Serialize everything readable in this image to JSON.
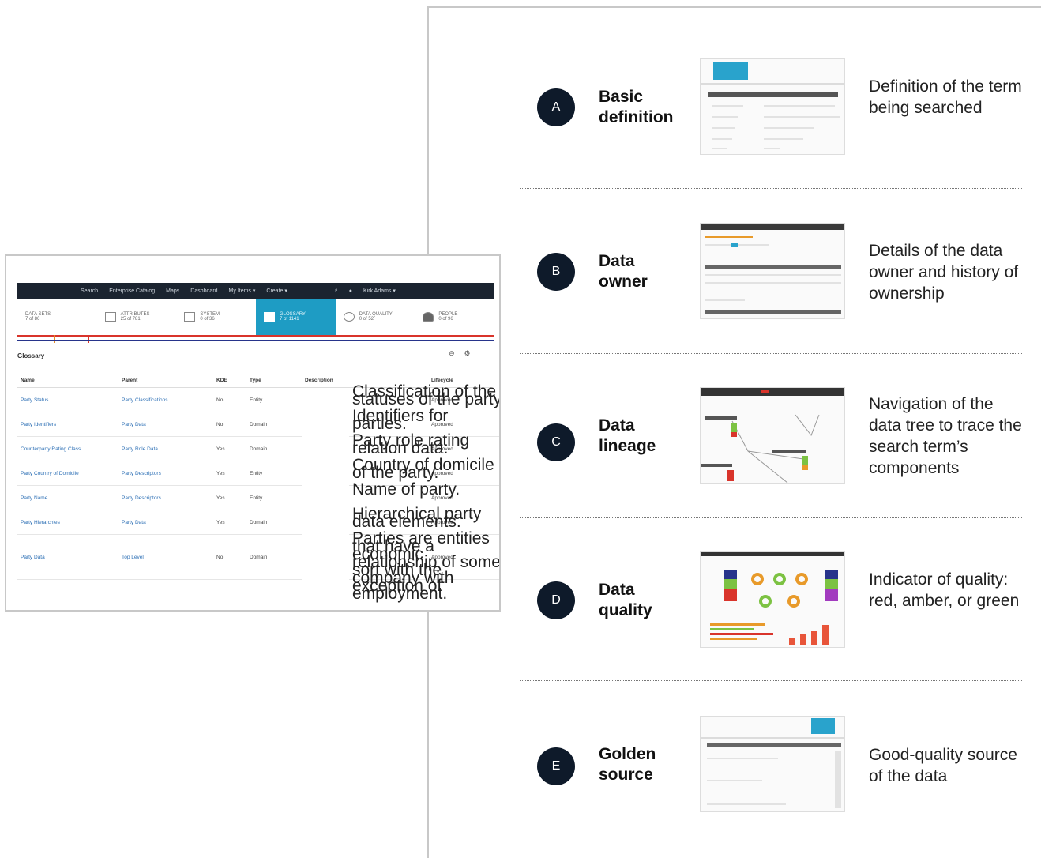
{
  "screenshot": {
    "nav": [
      "Search",
      "Enterprise Catalog",
      "Maps",
      "Dashboard",
      "My Items ▾",
      "Create ▾",
      "Kirk Adams ▾"
    ],
    "tiles": [
      {
        "label": "DATA SETS",
        "sub": "7 of 86"
      },
      {
        "label": "ATTRIBUTES",
        "sub": "25 of 781"
      },
      {
        "label": "SYSTEM",
        "sub": "0 of 36"
      },
      {
        "label": "GLOSSARY",
        "sub": "7 of 1141"
      },
      {
        "label": "DATA QUALITY",
        "sub": "0 of 52"
      },
      {
        "label": "PEOPLE",
        "sub": "0 of 96"
      }
    ],
    "glossary_title": "Glossary",
    "columns": [
      "Name",
      "Parent",
      "KDE",
      "Type",
      "Description",
      "Lifecycle"
    ],
    "rows": [
      {
        "name": "Party Status",
        "parent": "Party Classifications",
        "kde": "No",
        "type": "Entity",
        "description": "Classification of the statuses of the party.",
        "lifecycle": "Approved"
      },
      {
        "name": "Party Identifiers",
        "parent": "Party Data",
        "kde": "No",
        "type": "Domain",
        "description": "Identifiers for parties.",
        "lifecycle": "Approved"
      },
      {
        "name": "Counterparty Rating Class",
        "parent": "Party Role Data",
        "kde": "Yes",
        "type": "Domain",
        "description": "Party role rating relation data.",
        "lifecycle": "Approved"
      },
      {
        "name": "Party Country of Domicile",
        "parent": "Party Descriptors",
        "kde": "Yes",
        "type": "Entity",
        "description": "Country of domicile of the party.",
        "lifecycle": "Approved"
      },
      {
        "name": "Party Name",
        "parent": "Party Descriptors",
        "kde": "Yes",
        "type": "Entity",
        "description": "Name of party.",
        "lifecycle": "Approved"
      },
      {
        "name": "Party Hierarchies",
        "parent": "Party Data",
        "kde": "Yes",
        "type": "Domain",
        "description": "Hierarchical party data elements.",
        "lifecycle": "Approved"
      },
      {
        "name": "Party Data",
        "parent": "Top Level",
        "kde": "No",
        "type": "Domain",
        "description": "Parties are entities that have a economic relationship of some sort with the company with exception of employment.",
        "lifecycle": "Approved"
      }
    ]
  },
  "items": [
    {
      "letter": "A",
      "title_1": "Basic",
      "title_2": "definition",
      "description": "Definition of the term being searched"
    },
    {
      "letter": "B",
      "title_1": "Data",
      "title_2": "owner",
      "description": "Details of the data owner and history of ownership"
    },
    {
      "letter": "C",
      "title_1": "Data",
      "title_2": "lineage",
      "description": "Navigation of the data tree to trace the search term’s components"
    },
    {
      "letter": "D",
      "title_1": "Data",
      "title_2": "quality",
      "description": "Indicator of quality: red, amber, or green"
    },
    {
      "letter": "E",
      "title_1": "Golden",
      "title_2": "source",
      "description": "Good-quality source of the data"
    }
  ],
  "colors": {
    "accent_blue": "#1e9cc4",
    "badge": "#0e1a2a",
    "frame": "#c8c8c8",
    "red": "#d9342b",
    "amber": "#e89a2a",
    "green": "#7cc242"
  }
}
